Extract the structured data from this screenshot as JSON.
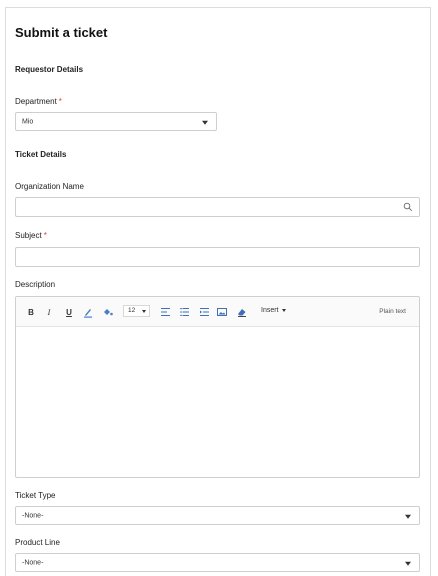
{
  "form": {
    "title": "Submit a ticket",
    "requestor_section": "Requestor Details",
    "department_label": "Department",
    "required_mark": "*",
    "department_value": "Mio",
    "ticket_section": "Ticket Details",
    "organization_label": "Organization Name",
    "organization_value": "",
    "subject_label": "Subject",
    "subject_value": "",
    "description_label": "Description",
    "ticket_type_label": "Ticket Type",
    "ticket_type_value": "-None-",
    "product_line_label": "Product Line",
    "product_line_value": "-None-"
  },
  "editor": {
    "bold": "B",
    "italic": "I",
    "underline": "U",
    "font_size": "12",
    "insert_label": "Insert",
    "plain_text_label": "Plain text",
    "icons": [
      "bold-icon",
      "italic-icon",
      "underline-icon",
      "text-color-icon",
      "background-color-icon",
      "align-icon",
      "bullet-list-icon",
      "indent-icon",
      "image-icon",
      "clear-format-icon"
    ]
  },
  "colors": {
    "required": "#e03a3a",
    "border": "#cfcfcf",
    "toolbar_bg": "#fafafa"
  }
}
